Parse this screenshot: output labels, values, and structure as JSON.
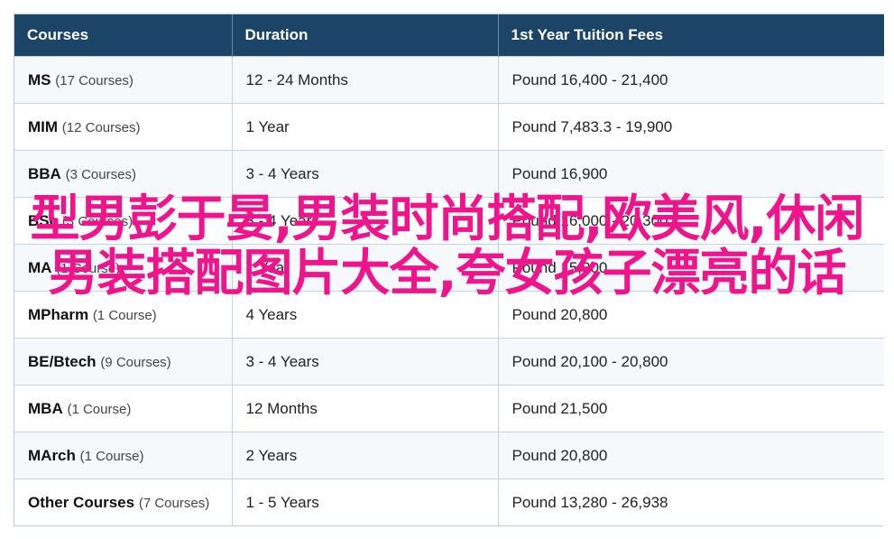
{
  "table": {
    "headers": [
      "Courses",
      "Duration",
      "1st Year Tuition Fees"
    ],
    "rows": [
      {
        "name": "MS",
        "count": "(17 Courses)",
        "duration": "12 - 24 Months",
        "fee": "Pound 16,400 - 21,400"
      },
      {
        "name": "MIM",
        "count": "(12 Courses)",
        "duration": "1 Year",
        "fee": "Pound 7,483.3 - 19,900"
      },
      {
        "name": "BBA",
        "count": "(3 Courses)",
        "duration": "3 - 4 Years",
        "fee": "Pound 16,900"
      },
      {
        "name": "BSc",
        "count": "(3 Courses)",
        "duration": "3 - 4 Years",
        "fee": "Pound 16,000 - 20,300"
      },
      {
        "name": "MA",
        "count": "(1 Course)",
        "duration": "1 Year",
        "fee": "Pound 15,900"
      },
      {
        "name": "MPharm",
        "count": "(1 Course)",
        "duration": "4 Years",
        "fee": "Pound 20,800"
      },
      {
        "name": "BE/Btech",
        "count": "(9 Courses)",
        "duration": "3 - 4 Years",
        "fee": "Pound 20,100 - 20,800"
      },
      {
        "name": "MBA",
        "count": "(1 Course)",
        "duration": "12 Months",
        "fee": "Pound 21,500"
      },
      {
        "name": "MArch",
        "count": "(1 Course)",
        "duration": "2 Years",
        "fee": "Pound 20,800"
      },
      {
        "name": "Other Courses",
        "count": "(7 Courses)",
        "duration": "1 - 5 Years",
        "fee": "Pound 13,280 - 26,938"
      }
    ]
  },
  "overlay_text": "型男彭于晏,男装时尚搭配,欧美风,休闲男装搭配图片大全,夸女孩子漂亮的话",
  "colors": {
    "header_bg": "#1c4466",
    "overlay": "#f0148c"
  }
}
